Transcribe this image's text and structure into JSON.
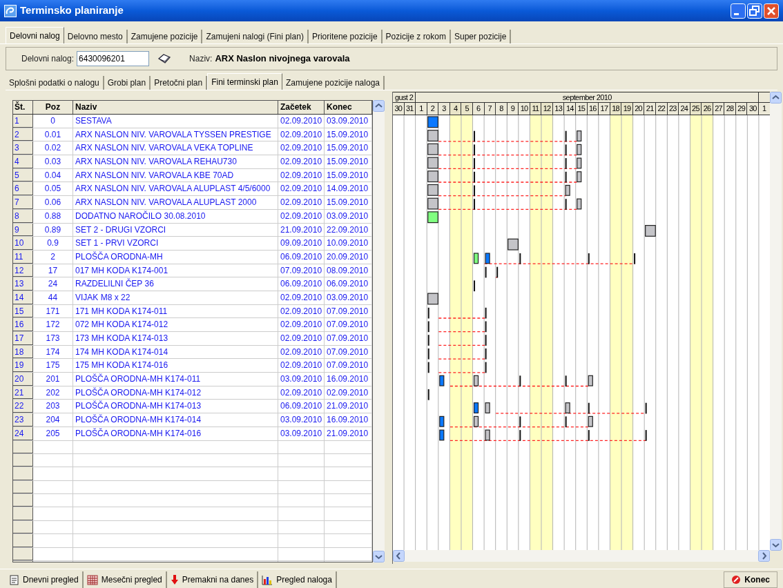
{
  "window": {
    "title": "Terminsko planiranje"
  },
  "tabs": [
    {
      "label": "Delovni nalog",
      "selected": true
    },
    {
      "label": "Delovno mesto",
      "selected": false
    },
    {
      "label": "Zamujene pozicije",
      "selected": false
    },
    {
      "label": "Zamujeni nalogi (Fini plan)",
      "selected": false
    },
    {
      "label": "Prioritene pozicije",
      "selected": false
    },
    {
      "label": "Pozicije z rokom",
      "selected": false
    },
    {
      "label": "Super pozicije",
      "selected": false
    }
  ],
  "order": {
    "label": "Delovni nalog:",
    "value": "6430096201",
    "name_label": "Naziv:",
    "name": "ARX Naslon nivojnega varovala"
  },
  "subtabs": [
    {
      "label": "Splošni podatki o nalogu",
      "selected": false
    },
    {
      "label": "Grobi plan",
      "selected": false
    },
    {
      "label": "Pretočni plan",
      "selected": false
    },
    {
      "label": "Fini terminski plan",
      "selected": true
    },
    {
      "label": "Zamujene pozicije naloga",
      "selected": false
    }
  ],
  "table": {
    "columns": [
      "Št.",
      "Poz",
      "Naziv",
      "Začetek",
      "Konec"
    ],
    "rows": [
      [
        "1",
        "0",
        "SESTAVA",
        "02.09.2010",
        "03.09.2010"
      ],
      [
        "2",
        "0.01",
        "ARX NASLON NIV. VAROVALA TYSSEN PRESTIGE",
        "02.09.2010",
        "15.09.2010"
      ],
      [
        "3",
        "0.02",
        "ARX NASLON NIV. VAROVALA VEKA TOPLINE",
        "02.09.2010",
        "15.09.2010"
      ],
      [
        "4",
        "0.03",
        "ARX NASLON NIV. VAROVALA REHAU730",
        "02.09.2010",
        "15.09.2010"
      ],
      [
        "5",
        "0.04",
        "ARX NASLON NIV. VAROVALA KBE 70AD",
        "02.09.2010",
        "15.09.2010"
      ],
      [
        "6",
        "0.05",
        "ARX NASLON NIV. VAROVALA ALUPLAST 4/5/6000",
        "02.09.2010",
        "14.09.2010"
      ],
      [
        "7",
        "0.06",
        "ARX NASLON NIV. VAROVALA ALUPLAST 2000",
        "02.09.2010",
        "15.09.2010"
      ],
      [
        "8",
        "0.88",
        "DODATNO NAROČILO 30.08.2010",
        "02.09.2010",
        "03.09.2010"
      ],
      [
        "9",
        "0.89",
        "SET 2 - DRUGI VZORCI",
        "21.09.2010",
        "22.09.2010"
      ],
      [
        "10",
        "0.9",
        "SET 1 - PRVI VZORCI",
        "09.09.2010",
        "10.09.2010"
      ],
      [
        "11",
        "2",
        "PLOŠČA ORODNA-MH",
        "06.09.2010",
        "20.09.2010"
      ],
      [
        "12",
        "17",
        "017 MH KODA K174-001",
        "07.09.2010",
        "08.09.2010"
      ],
      [
        "13",
        "24",
        "RAZDELILNI ČEP 36",
        "06.09.2010",
        "06.09.2010"
      ],
      [
        "14",
        "44",
        "VIJAK M8 x 22",
        "02.09.2010",
        "03.09.2010"
      ],
      [
        "15",
        "171",
        "171 MH KODA K174-011",
        "02.09.2010",
        "07.09.2010"
      ],
      [
        "16",
        "172",
        "072 MH KODA K174-012",
        "02.09.2010",
        "07.09.2010"
      ],
      [
        "17",
        "173",
        "173 MH KODA K174-013",
        "02.09.2010",
        "07.09.2010"
      ],
      [
        "18",
        "174",
        "174 MH KODA K174-014",
        "02.09.2010",
        "07.09.2010"
      ],
      [
        "19",
        "175",
        "175 MH KODA K174-016",
        "02.09.2010",
        "07.09.2010"
      ],
      [
        "20",
        "201",
        "PLOŠČA ORODNA-MH K174-011",
        "03.09.2010",
        "16.09.2010"
      ],
      [
        "21",
        "202",
        "PLOŠČA ORODNA-MH K174-012",
        "02.09.2010",
        "02.09.2010"
      ],
      [
        "22",
        "203",
        "PLOŠČA ORODNA-MH K174-013",
        "06.09.2010",
        "21.09.2010"
      ],
      [
        "23",
        "204",
        "PLOŠČA ORODNA-MH K174-014",
        "03.09.2010",
        "16.09.2010"
      ],
      [
        "24",
        "205",
        "PLOŠČA ORODNA-MH K174-016",
        "03.09.2010",
        "21.09.2010"
      ]
    ]
  },
  "gantt": {
    "months": [
      {
        "label": "gust 2"
      },
      {
        "label": "september 2010"
      }
    ],
    "days": [
      {
        "label": "30",
        "weekend": false
      },
      {
        "label": "31",
        "weekend": false
      },
      {
        "label": "1",
        "weekend": false
      },
      {
        "label": "2",
        "weekend": false
      },
      {
        "label": "3",
        "weekend": false
      },
      {
        "label": "4",
        "weekend": true
      },
      {
        "label": "5",
        "weekend": true
      },
      {
        "label": "6",
        "weekend": false
      },
      {
        "label": "7",
        "weekend": false
      },
      {
        "label": "8",
        "weekend": false
      },
      {
        "label": "9",
        "weekend": false
      },
      {
        "label": "10",
        "weekend": false
      },
      {
        "label": "11",
        "weekend": true
      },
      {
        "label": "12",
        "weekend": true
      },
      {
        "label": "13",
        "weekend": false
      },
      {
        "label": "14",
        "weekend": false
      },
      {
        "label": "15",
        "weekend": false
      },
      {
        "label": "16",
        "weekend": false
      },
      {
        "label": "17",
        "weekend": false
      },
      {
        "label": "18",
        "weekend": true
      },
      {
        "label": "19",
        "weekend": true
      },
      {
        "label": "20",
        "weekend": false
      },
      {
        "label": "21",
        "weekend": false
      },
      {
        "label": "22",
        "weekend": false
      },
      {
        "label": "23",
        "weekend": false
      },
      {
        "label": "24",
        "weekend": false
      },
      {
        "label": "25",
        "weekend": true
      },
      {
        "label": "26",
        "weekend": true
      },
      {
        "label": "27",
        "weekend": false
      },
      {
        "label": "28",
        "weekend": false
      },
      {
        "label": "29",
        "weekend": false
      },
      {
        "label": "30",
        "weekend": false
      },
      {
        "label": "1",
        "weekend": false
      }
    ]
  },
  "toolbar": [
    "Dnevni pregled",
    "Mesečni pregled",
    "Premakni na danes",
    "Pregled naloga"
  ],
  "close_button": "Konec"
}
